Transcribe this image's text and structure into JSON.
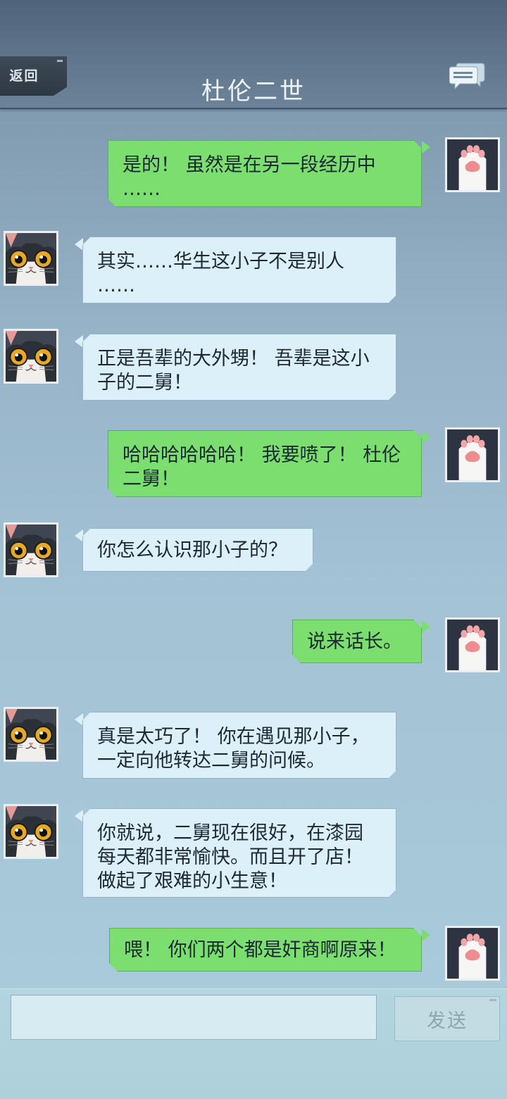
{
  "header": {
    "back_label": "返回",
    "title": "杜伦二世",
    "chat_icon": "chat-bubbles-icon"
  },
  "messages": [
    {
      "sender": "me",
      "text": "是的！ 虽然是在另一段经历中\n……"
    },
    {
      "sender": "npc",
      "text": "其实……华生这小子不是别人\n……"
    },
    {
      "sender": "npc",
      "text": "正是吾辈的大外甥！ 吾辈是这小\n子的二舅！"
    },
    {
      "sender": "me",
      "text": "哈哈哈哈哈哈！ 我要喷了！ 杜伦\n二舅！"
    },
    {
      "sender": "npc",
      "text": "你怎么认识那小子的？"
    },
    {
      "sender": "me",
      "text": "说来话长。"
    },
    {
      "sender": "npc",
      "text": "真是太巧了！ 你在遇见那小子，\n一定向他转达二舅的问候。"
    },
    {
      "sender": "npc",
      "text": "你就说，二舅现在很好，在漆园\n每天都非常愉快。而且开了店！\n做起了艰难的小生意！"
    },
    {
      "sender": "me",
      "text": "喂！ 你们两个都是奸商啊原来！"
    }
  ],
  "avatars": {
    "npc": "cat-face-avatar",
    "me": "cat-paw-avatar"
  },
  "input": {
    "value": "",
    "placeholder": "",
    "send_label": "发送"
  },
  "colors": {
    "my_bubble": "#7bdf70",
    "npc_bubble": "#dbf0f8",
    "header": "#5d7389"
  }
}
